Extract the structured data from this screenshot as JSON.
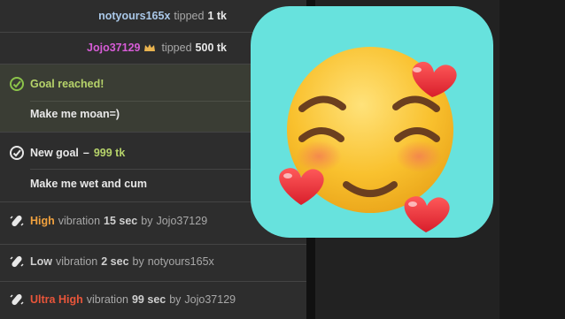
{
  "chat": {
    "tip1": {
      "user": "notyours165x",
      "action": "tipped",
      "amount": "1 tk"
    },
    "tip2": {
      "user": "Jojo37129",
      "action": "tipped",
      "amount": "500 tk"
    },
    "goal_reached": {
      "title": "Goal reached!",
      "text": "Make me moan=)"
    },
    "new_goal": {
      "label": "New goal",
      "dash": "–",
      "amount": "999 tk",
      "text": "Make me wet and cum"
    },
    "vibrations": [
      {
        "level": "High",
        "word": "vibration",
        "duration": "15 sec",
        "by": "by",
        "user": "Jojo37129"
      },
      {
        "level": "Low",
        "word": "vibration",
        "duration": "2 sec",
        "by": "by",
        "user": "notyours165x"
      },
      {
        "level": "Ultra High",
        "word": "vibration",
        "duration": "99 sec",
        "by": "by",
        "user": "Jojo37129"
      }
    ]
  },
  "colors": {
    "tile": "#67e2dd",
    "goal_bg": "#3a3d34",
    "goal_text": "#b6d36a",
    "high": "#f0a13e",
    "ultra_high": "#e8553a",
    "jojo": "#d65cd6",
    "crown": "#e9b450"
  },
  "icons": [
    "goal-check-icon",
    "vibration-icon",
    "crown-icon",
    "smiling-face-with-hearts-emoji"
  ]
}
